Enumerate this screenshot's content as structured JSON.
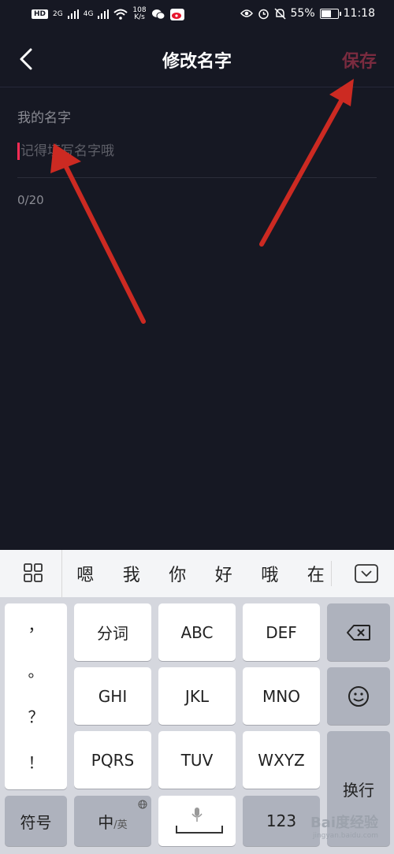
{
  "status_bar": {
    "hd": "HD",
    "net1": "2G",
    "net2": "4G",
    "speed_top": "108",
    "speed_bottom": "K/s",
    "battery": "55%",
    "time": "11:18",
    "battery_level": 0.55
  },
  "header": {
    "title": "修改名字",
    "save_label": "保存"
  },
  "form": {
    "label": "我的名字",
    "placeholder": "记得填写名字哦",
    "value": "",
    "counter": "0/20"
  },
  "keyboard": {
    "candidates": [
      "嗯",
      "我",
      "你",
      "好",
      "哦",
      "在"
    ],
    "punctuation": [
      "，",
      "。",
      "？",
      "！"
    ],
    "keys": {
      "fenci": "分词",
      "abc": "ABC",
      "def": "DEF",
      "ghi": "GHI",
      "jkl": "JKL",
      "mno": "MNO",
      "pqrs": "PQRS",
      "tuv": "TUV",
      "wxyz": "WXYZ",
      "fuhao": "符号",
      "zh": "中",
      "en": "/英",
      "num": "123",
      "huanhang": "换行"
    },
    "watermark": "Bai度经验",
    "watermark_sub": "jingyan.baidu.com"
  },
  "colors": {
    "background": "#161823",
    "accent": "#fe2c55",
    "save_disabled": "#7a2b3f",
    "annotation_arrow": "#cc2a22"
  },
  "icons": [
    "back-arrow-icon",
    "menu-grid-icon",
    "collapse-keyboard-icon",
    "backspace-icon",
    "emoji-icon",
    "microphone-icon",
    "globe-icon"
  ]
}
